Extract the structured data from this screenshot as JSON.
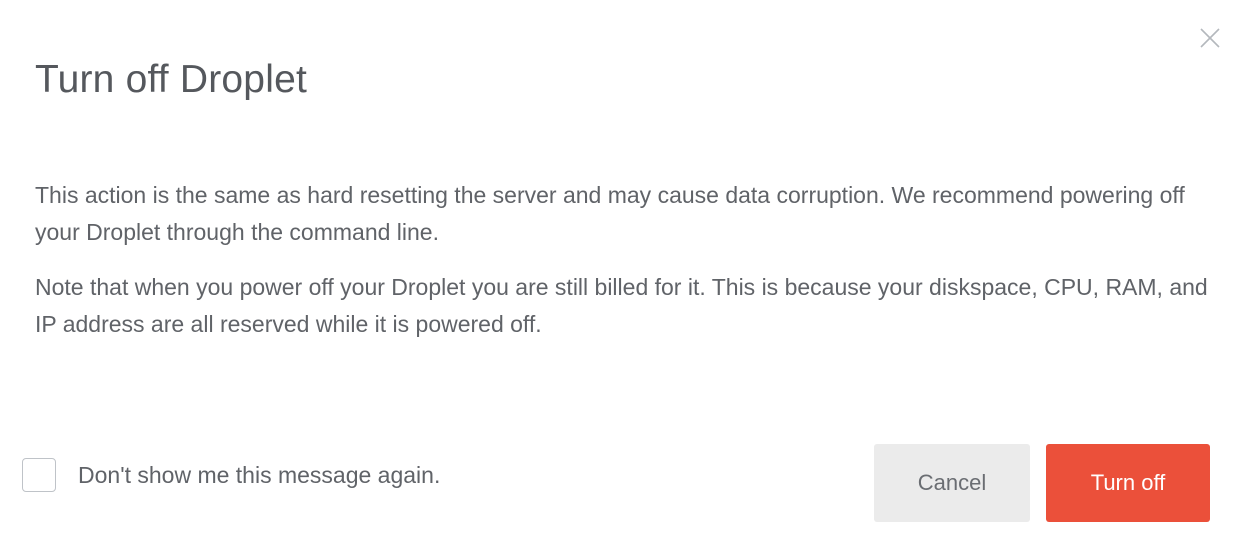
{
  "dialog": {
    "title": "Turn off Droplet",
    "close_icon": "close-icon",
    "paragraphs": [
      "This action is the same as hard resetting the server and may cause data corruption. We recommend powering off your Droplet through the command line.",
      "Note that when you power off your Droplet you are still billed for it. This is because your diskspace, CPU, RAM, and IP address are all reserved while it is powered off."
    ],
    "checkbox": {
      "label": "Don't show me this message again.",
      "checked": false
    },
    "buttons": {
      "cancel_label": "Cancel",
      "confirm_label": "Turn off"
    },
    "colors": {
      "confirm": "#eb503a",
      "cancel_bg": "#ebebeb",
      "text": "#55585d"
    }
  }
}
